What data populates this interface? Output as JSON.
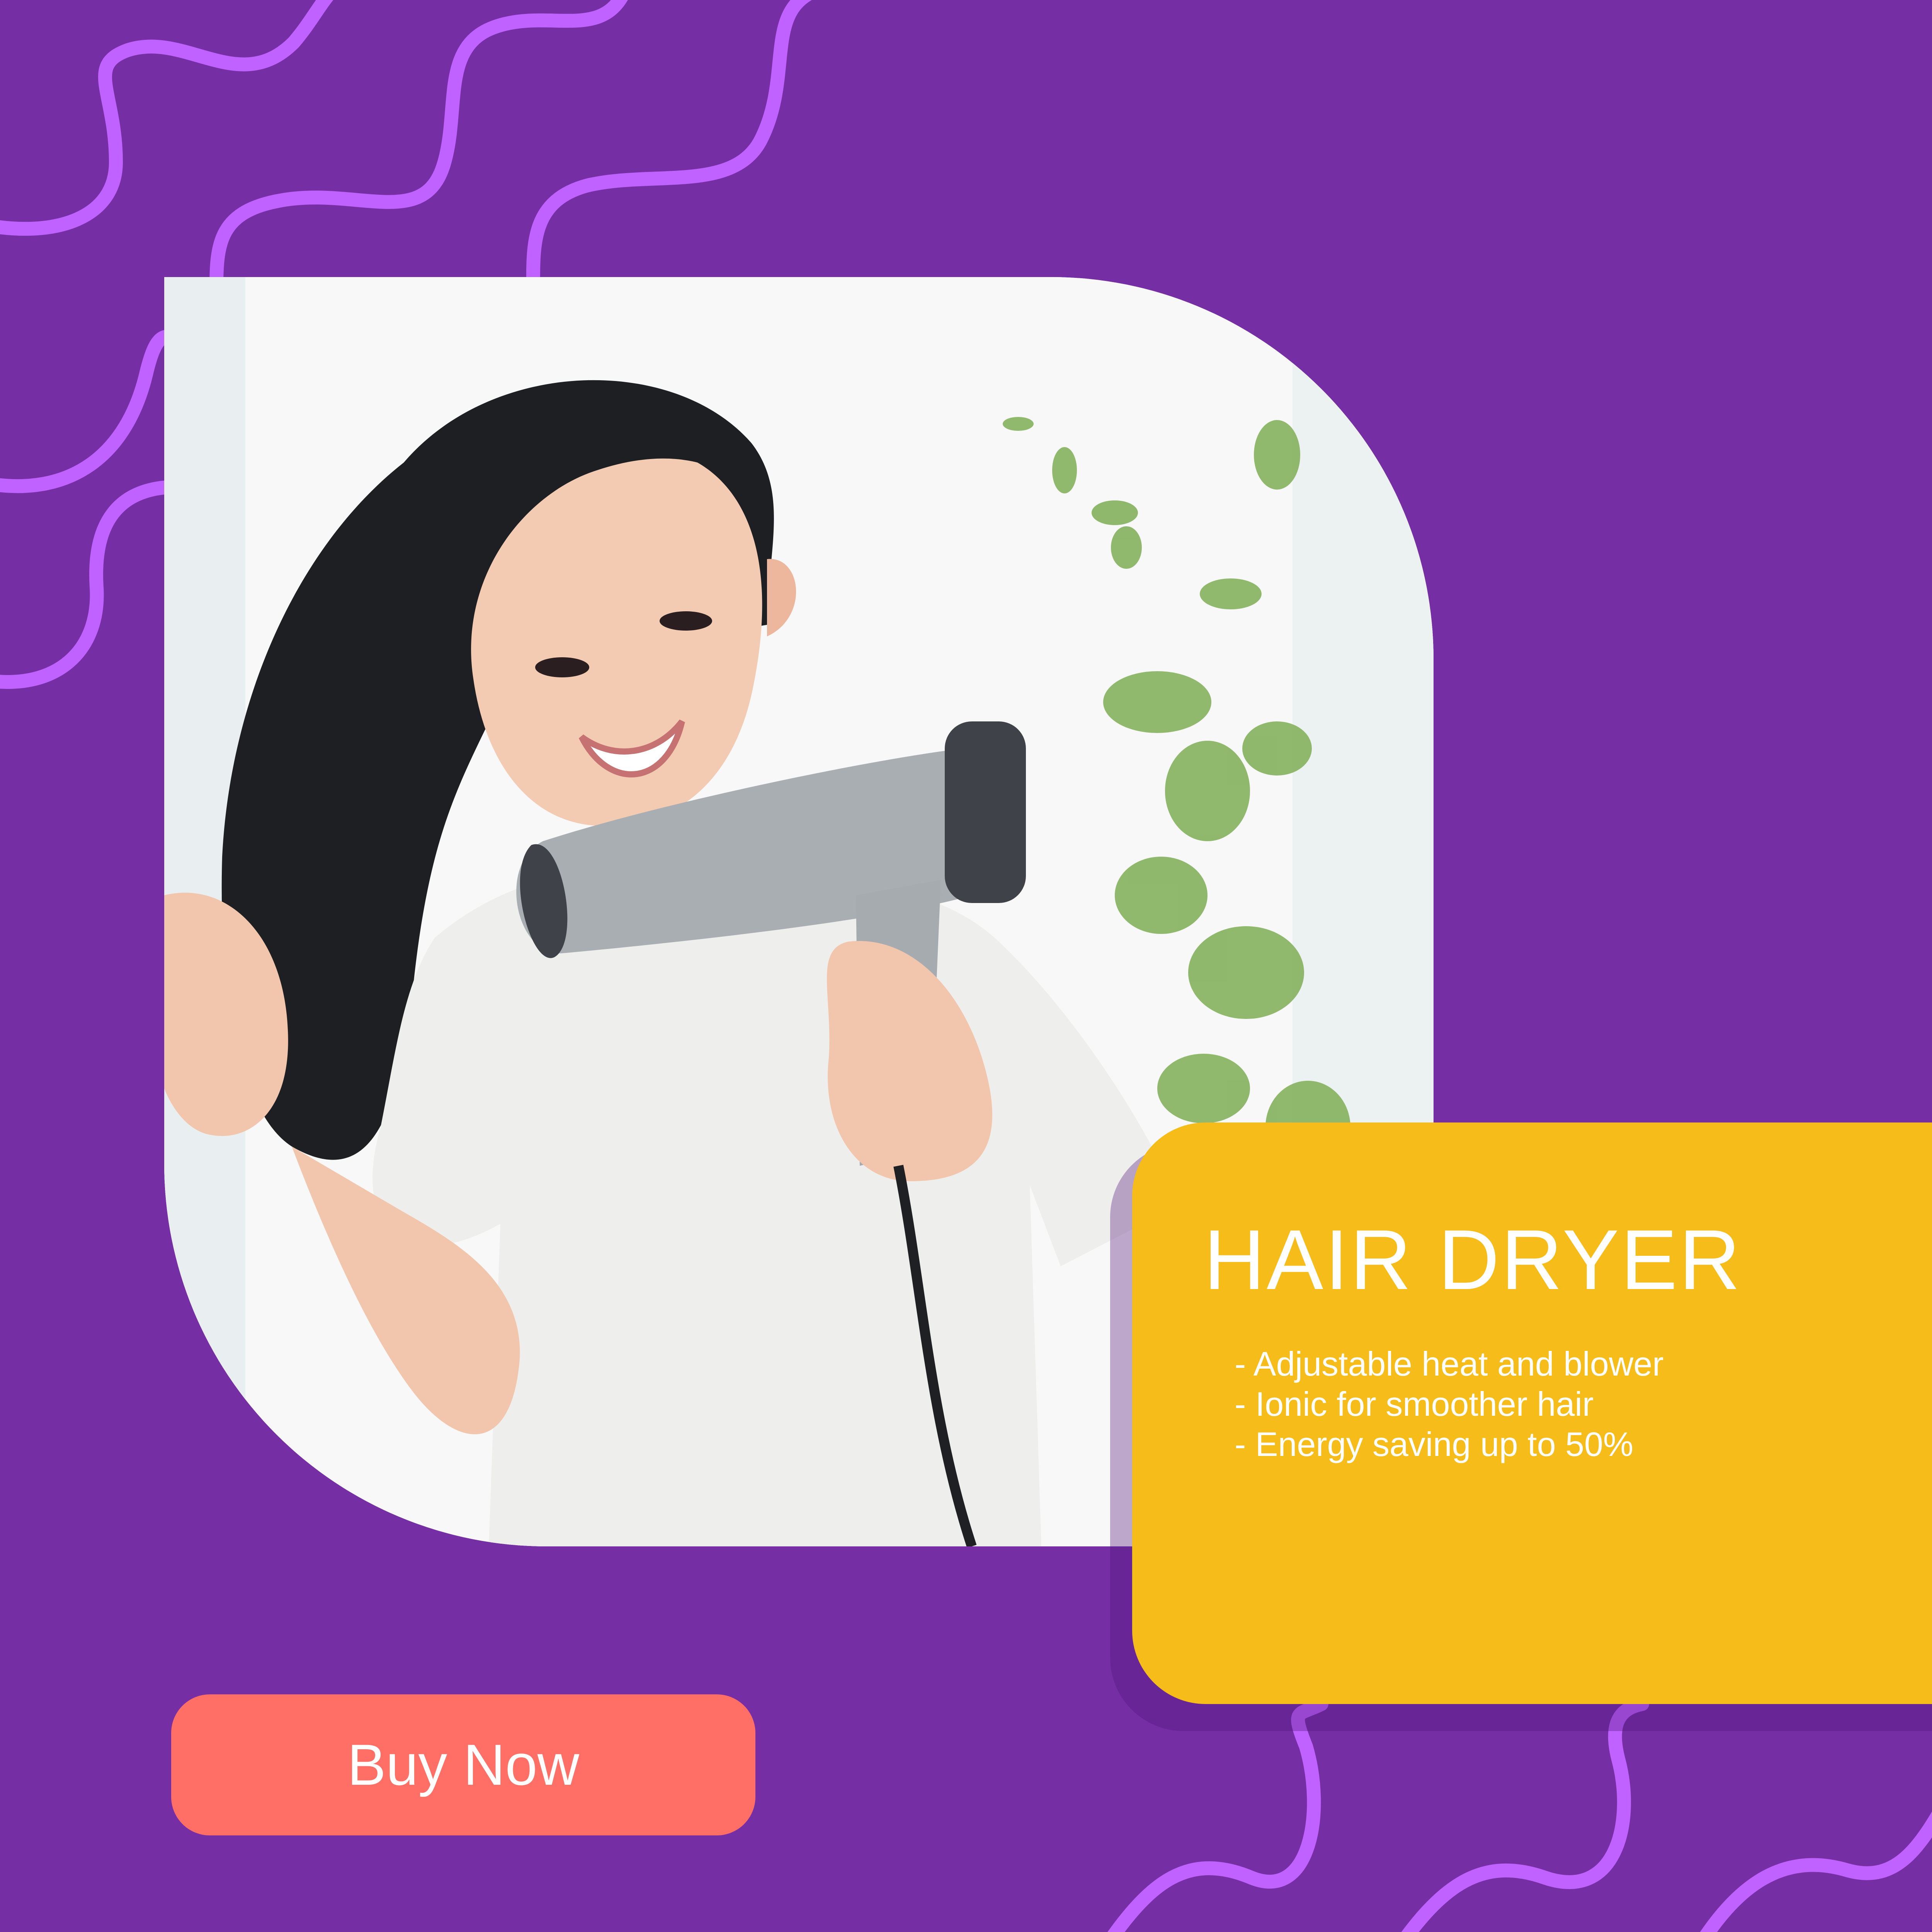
{
  "colors": {
    "background": "#762EA5",
    "wave_line": "#C062FF",
    "info_card": "#F6BC19",
    "buy_button": "#FF6F66",
    "text_light": "#FFFFFF"
  },
  "product": {
    "title": "HAIR DRYER",
    "features": [
      "- Adjustable heat and blower",
      "- Ionic for smoother hair",
      "- Energy saving up to 50%"
    ]
  },
  "cta": {
    "label": "Buy Now"
  },
  "photo": {
    "subject": "woman-using-hair-dryer"
  }
}
